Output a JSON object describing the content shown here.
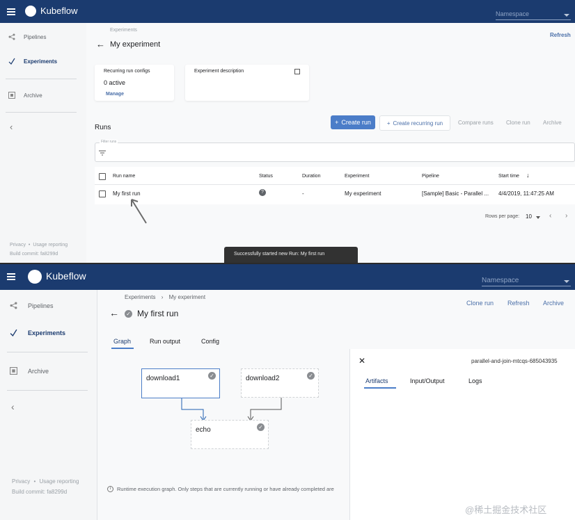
{
  "app": {
    "brand": "Kubeflow",
    "namespace_placeholder": "Namespace"
  },
  "sidebar": {
    "items": [
      {
        "label": "Pipelines",
        "icon": "pipelines-icon"
      },
      {
        "label": "Experiments",
        "icon": "experiments-icon"
      },
      {
        "label": "Archive",
        "icon": "archive-icon"
      }
    ],
    "collapse_icon": "‹",
    "footer_privacy": "Privacy",
    "footer_sep": "•",
    "footer_usage": "Usage reporting",
    "footer_build": "Build commit: fa8299d"
  },
  "experiment_view": {
    "breadcrumb": "Experiments",
    "title": "My experiment",
    "refresh": "Refresh",
    "recurring_card": {
      "title": "Recurring run configs",
      "value": "0 active",
      "link": "Manage"
    },
    "description_card": {
      "title": "Experiment description"
    },
    "runs_heading": "Runs",
    "buttons": {
      "create_run": "Create run",
      "create_recurring": "Create recurring run",
      "compare": "Compare runs",
      "clone": "Clone run",
      "archive": "Archive"
    },
    "filter_label": "Filter runs",
    "table": {
      "headers": [
        "Run name",
        "Status",
        "Duration",
        "Experiment",
        "Pipeline",
        "Start time"
      ],
      "sort_icon": "↓",
      "row": {
        "name": "My first run",
        "status_icon": "?",
        "duration": "-",
        "experiment": "My experiment",
        "pipeline": "[Sample] Basic - Parallel ...",
        "start_time": "4/4/2019, 11:47:25 AM"
      }
    },
    "pagination": {
      "label": "Rows per page:",
      "value": "10"
    },
    "snackbar": "Successfully started new Run: My first run"
  },
  "run_view": {
    "breadcrumb_root": "Experiments",
    "breadcrumb_sep": "›",
    "breadcrumb_current": "My experiment",
    "title": "My first run",
    "actions": {
      "clone": "Clone run",
      "refresh": "Refresh",
      "archive": "Archive"
    },
    "tabs": [
      "Graph",
      "Run output",
      "Config"
    ],
    "nodes": {
      "download1": "download1",
      "download2": "download2",
      "echo": "echo"
    },
    "info_icon": "i",
    "note": "Runtime execution graph. Only steps that are currently running or have already completed are",
    "side_panel": {
      "close_icon": "✕",
      "node_id": "parallel-and-join-mtcqs-685043935",
      "tabs": [
        "Artifacts",
        "Input/Output",
        "Logs"
      ]
    }
  },
  "watermark": "@稀土掘金技术社区",
  "colors": {
    "header": "#1b3b6f",
    "accent": "#4b7dc8",
    "background": "#f8f9fa"
  }
}
